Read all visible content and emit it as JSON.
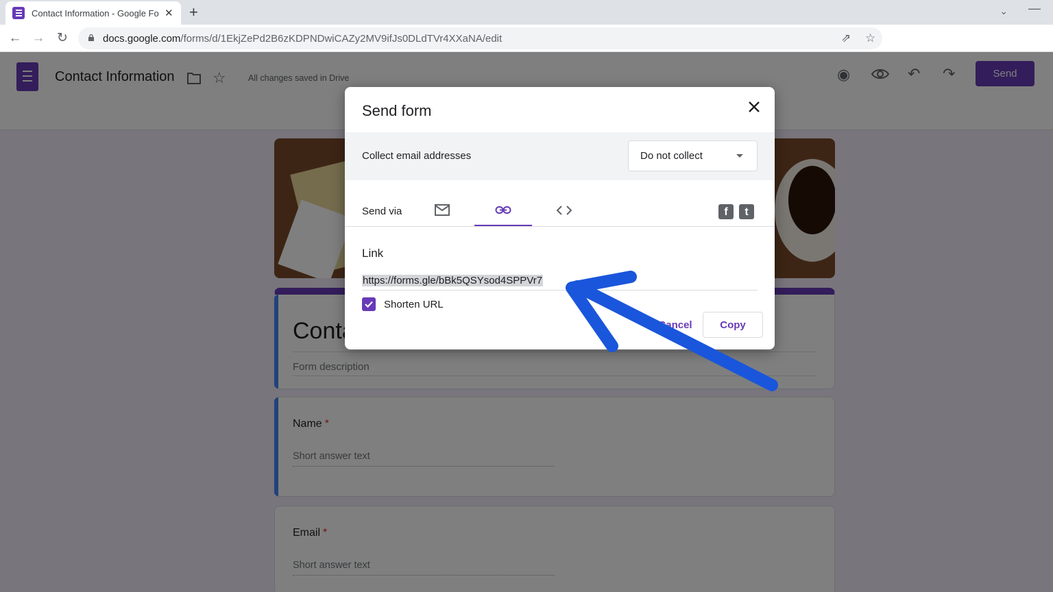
{
  "browser": {
    "tab_title": "Contact Information - Google Forms",
    "new_tab": "+",
    "tab_close": "✕",
    "url_host": "docs.google.com",
    "url_path": "/forms/d/1EkjZePd2B6zKDPNDwiCAZy2MV9ifJs0DLdTVr4XXaNA/edit"
  },
  "app": {
    "doc_title": "Contact Information",
    "saved_status": "All changes saved in Drive",
    "send_label": "Send"
  },
  "form": {
    "title": "Contact Information",
    "description_placeholder": "Form description",
    "questions": [
      {
        "label": "Name",
        "required_mark": "*",
        "hint": "Short answer text"
      },
      {
        "label": "Email",
        "required_mark": "*",
        "hint": "Short answer text"
      }
    ]
  },
  "dialog": {
    "title": "Send form",
    "collect_label": "Collect email addresses",
    "collect_value": "Do not collect",
    "send_via_label": "Send via",
    "link_label": "Link",
    "link_url": "https://forms.gle/bBk5QSYsod4SPPVr7",
    "shorten_label": "Shorten URL",
    "shorten_checked": true,
    "cancel_label": "Cancel",
    "copy_label": "Copy",
    "active_tab": "link",
    "social": {
      "facebook": "f",
      "twitter": "t"
    }
  },
  "colors": {
    "accent": "#673ab7",
    "annotation_arrow": "#1a56db"
  },
  "icons": [
    "lock-icon",
    "share-icon",
    "bookmark-star-icon",
    "folder-icon",
    "star-icon",
    "palette-icon",
    "preview-eye-icon",
    "undo-icon",
    "redo-icon",
    "close-icon",
    "email-icon",
    "link-icon",
    "embed-code-icon",
    "facebook-icon",
    "twitter-icon",
    "check-icon"
  ]
}
